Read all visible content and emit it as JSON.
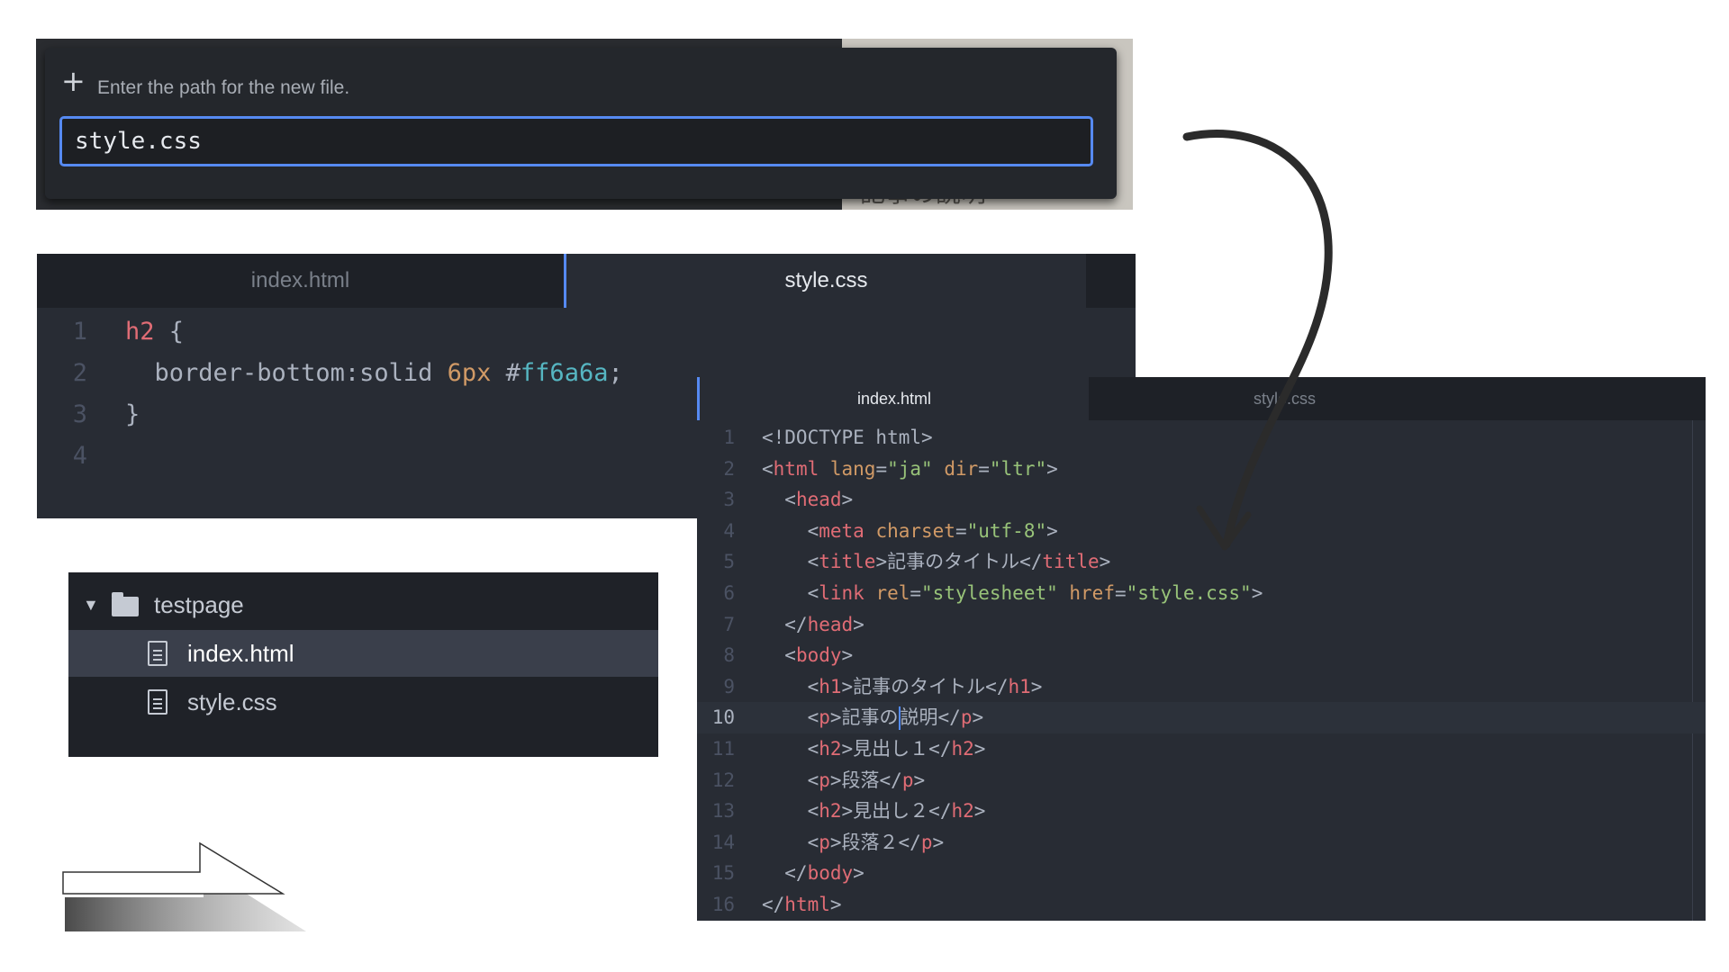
{
  "new_file_prompt": {
    "background_text": "記事の説明",
    "label": "Enter the path for the new file.",
    "input_value": "style.css"
  },
  "css_editor": {
    "tabs": [
      {
        "label": "index.html",
        "active": false
      },
      {
        "label": "style.css",
        "active": true
      }
    ],
    "lines": [
      {
        "number": "1",
        "tokens": [
          [
            "tag",
            "h2"
          ],
          [
            "punct",
            " {"
          ]
        ]
      },
      {
        "number": "2",
        "tokens": [
          [
            "text",
            "  border-bottom:solid "
          ],
          [
            "num",
            "6px"
          ],
          [
            "text",
            " #"
          ],
          [
            "hex",
            "ff6a6a"
          ],
          [
            "punct",
            ";"
          ]
        ]
      },
      {
        "number": "3",
        "tokens": [
          [
            "punct",
            "}"
          ]
        ]
      },
      {
        "number": "4",
        "tokens": []
      }
    ]
  },
  "tree_view": {
    "folder": "testpage",
    "files": [
      {
        "name": "index.html",
        "selected": true
      },
      {
        "name": "style.css",
        "selected": false
      }
    ]
  },
  "html_editor": {
    "tabs": [
      {
        "label": "index.html",
        "active": true
      },
      {
        "label": "style.css",
        "active": false
      }
    ],
    "current_line": 10,
    "lines": [
      {
        "number": "1",
        "tokens": [
          [
            "text",
            "<!DOCTYPE html>"
          ]
        ]
      },
      {
        "number": "2",
        "tokens": [
          [
            "punct",
            "<"
          ],
          [
            "tag",
            "html"
          ],
          [
            "attr",
            " lang"
          ],
          [
            "punct",
            "="
          ],
          [
            "str",
            "\"ja\""
          ],
          [
            "attr",
            " dir"
          ],
          [
            "punct",
            "="
          ],
          [
            "str",
            "\"ltr\""
          ],
          [
            "punct",
            ">"
          ]
        ]
      },
      {
        "number": "3",
        "tokens": [
          [
            "punct",
            "  <"
          ],
          [
            "tag",
            "head"
          ],
          [
            "punct",
            ">"
          ]
        ]
      },
      {
        "number": "4",
        "tokens": [
          [
            "punct",
            "    <"
          ],
          [
            "tag",
            "meta"
          ],
          [
            "attr",
            " charset"
          ],
          [
            "punct",
            "="
          ],
          [
            "str",
            "\"utf-8\""
          ],
          [
            "punct",
            ">"
          ]
        ]
      },
      {
        "number": "5",
        "tokens": [
          [
            "punct",
            "    <"
          ],
          [
            "tag",
            "title"
          ],
          [
            "punct",
            ">"
          ],
          [
            "text",
            "記事のタイトル"
          ],
          [
            "punct",
            "</"
          ],
          [
            "tag",
            "title"
          ],
          [
            "punct",
            ">"
          ]
        ]
      },
      {
        "number": "6",
        "tokens": [
          [
            "punct",
            "    <"
          ],
          [
            "tag",
            "link"
          ],
          [
            "attr",
            " rel"
          ],
          [
            "punct",
            "="
          ],
          [
            "str",
            "\"stylesheet\""
          ],
          [
            "attr",
            " href"
          ],
          [
            "punct",
            "="
          ],
          [
            "str",
            "\"style.css\""
          ],
          [
            "punct",
            ">"
          ]
        ]
      },
      {
        "number": "7",
        "tokens": [
          [
            "punct",
            "  </"
          ],
          [
            "tag",
            "head"
          ],
          [
            "punct",
            ">"
          ]
        ]
      },
      {
        "number": "8",
        "tokens": [
          [
            "punct",
            "  <"
          ],
          [
            "tag",
            "body"
          ],
          [
            "punct",
            ">"
          ]
        ]
      },
      {
        "number": "9",
        "tokens": [
          [
            "punct",
            "    <"
          ],
          [
            "tag",
            "h1"
          ],
          [
            "punct",
            ">"
          ],
          [
            "text",
            "記事のタイトル"
          ],
          [
            "punct",
            "</"
          ],
          [
            "tag",
            "h1"
          ],
          [
            "punct",
            ">"
          ]
        ]
      },
      {
        "number": "10",
        "tokens": [
          [
            "punct",
            "    <"
          ],
          [
            "tag",
            "p"
          ],
          [
            "punct",
            ">"
          ],
          [
            "text",
            "記事の"
          ],
          [
            "cursor",
            ""
          ],
          [
            "text",
            "説明"
          ],
          [
            "punct",
            "</"
          ],
          [
            "tag",
            "p"
          ],
          [
            "punct",
            ">"
          ]
        ]
      },
      {
        "number": "11",
        "tokens": [
          [
            "punct",
            "    <"
          ],
          [
            "tag",
            "h2"
          ],
          [
            "punct",
            ">"
          ],
          [
            "text",
            "見出し１"
          ],
          [
            "punct",
            "</"
          ],
          [
            "tag",
            "h2"
          ],
          [
            "punct",
            ">"
          ]
        ]
      },
      {
        "number": "12",
        "tokens": [
          [
            "punct",
            "    <"
          ],
          [
            "tag",
            "p"
          ],
          [
            "punct",
            ">"
          ],
          [
            "text",
            "段落"
          ],
          [
            "punct",
            "</"
          ],
          [
            "tag",
            "p"
          ],
          [
            "punct",
            ">"
          ]
        ]
      },
      {
        "number": "13",
        "tokens": [
          [
            "punct",
            "    <"
          ],
          [
            "tag",
            "h2"
          ],
          [
            "punct",
            ">"
          ],
          [
            "text",
            "見出し２"
          ],
          [
            "punct",
            "</"
          ],
          [
            "tag",
            "h2"
          ],
          [
            "punct",
            ">"
          ]
        ]
      },
      {
        "number": "14",
        "tokens": [
          [
            "punct",
            "    <"
          ],
          [
            "tag",
            "p"
          ],
          [
            "punct",
            ">"
          ],
          [
            "text",
            "段落２"
          ],
          [
            "punct",
            "</"
          ],
          [
            "tag",
            "p"
          ],
          [
            "punct",
            ">"
          ]
        ]
      },
      {
        "number": "15",
        "tokens": [
          [
            "punct",
            "  </"
          ],
          [
            "tag",
            "body"
          ],
          [
            "punct",
            ">"
          ]
        ]
      },
      {
        "number": "16",
        "tokens": [
          [
            "punct",
            "</"
          ],
          [
            "tag",
            "html"
          ],
          [
            "punct",
            ">"
          ]
        ]
      }
    ]
  },
  "colors": {
    "accent": "#568af2",
    "editor_bg": "#282c34",
    "tag": "#e06c75",
    "attr": "#d19a66",
    "string": "#98c379"
  },
  "icons": [
    "plus-icon",
    "chevron-down-icon",
    "folder-icon",
    "file-icon",
    "curved-arrow",
    "right-arrow"
  ]
}
